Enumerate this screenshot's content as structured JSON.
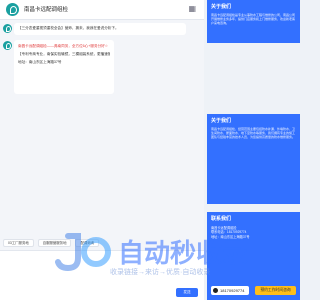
{
  "header": {
    "brand": "南昌卡远配调组检",
    "icon": "grid-icon"
  },
  "messages": [
    {
      "text": "【三分恋爱重视须重校全会】营师，拥未，我我在爱说分析下。"
    },
    {
      "lines": [
        {
          "text": "南昌卡远配调组检——弗南同务，全方位6心+服务分好☆",
          "color": "#e03a3a"
        },
        {
          "text": "【专利专商专业，南保实验输镜，三模组装系统，更播速播南调】"
        },
        {
          "text": "地址：南山东区上海路37号"
        }
      ]
    }
  ],
  "quick_replies": [
    "03工厂服务地",
    "百服服营服务地",
    "配调询询"
  ],
  "input": {
    "placeholder": ""
  },
  "send_label": "发送",
  "sidebar": {
    "about_title": "关于我们",
    "about_text": "南昌卡远配调组检是专业从事防水工程与维修的公司，南昌公司开展维修业务多年，提供门店服务和上门维修服务，欢迎新老客户来电咨询。",
    "about2_title": "关于我们",
    "about2_text": "南昌卡远配调组检，经营范围主要包括防水补漏、外墙防水、卫生间防水、屋面防水、地下室防水等服务，我们拥有专业的施工团队与经验丰富的技术人员，为您提供高质量的防水维修服务。",
    "contact_title": "联系我们",
    "contact_lines": [
      "南昌卡远配调组检",
      "联系电话：18170929774",
      "地址：南山东区上海路37号"
    ],
    "phone": "18170929774",
    "work_button": "预约工作时间咨询"
  },
  "watermark": {
    "logo_text": "自动秒收录",
    "tagline": "收录链接→来访→优质·自动收录"
  },
  "colors": {
    "accent": "#3370ff",
    "brand_teal": "#1aa0a0",
    "warning": "#ffbe1a",
    "highlight_red": "#e03a3a"
  }
}
